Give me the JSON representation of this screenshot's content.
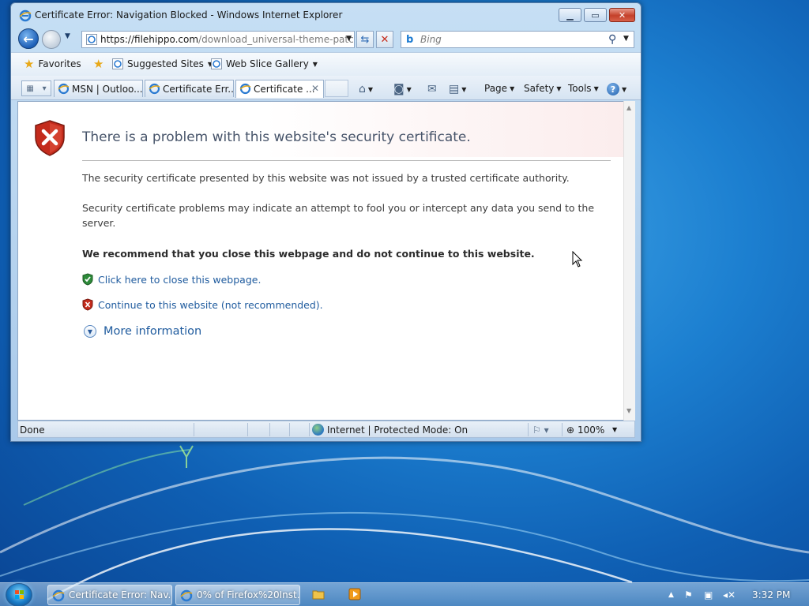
{
  "window": {
    "title": "Certificate Error: Navigation Blocked - Windows Internet Explorer"
  },
  "address": {
    "host": "https://filehippo.com",
    "path": "/download_universal-theme-patcher"
  },
  "search": {
    "placeholder": "Bing"
  },
  "favorites_bar": {
    "favorites": "Favorites",
    "suggested": "Suggested Sites",
    "web_slice": "Web Slice Gallery"
  },
  "tabs": [
    {
      "label": "MSN | Outloo...",
      "active": false
    },
    {
      "label": "Certificate Err...",
      "active": false
    },
    {
      "label": "Certificate ...",
      "active": true
    }
  ],
  "command_bar": {
    "page": "Page",
    "safety": "Safety",
    "tools": "Tools"
  },
  "content": {
    "title": "There is a problem with this website's security certificate.",
    "p1": "The security certificate presented by this website was not issued by a trusted certificate authority.",
    "p2": "Security certificate problems may indicate an attempt to fool you or intercept any data you send to the server.",
    "recommend": "We recommend that you close this webpage and do not continue to this website.",
    "close_link": "Click here to close this webpage.",
    "continue_link": "Continue to this website (not recommended).",
    "more_info": "More information"
  },
  "status_bar": {
    "status": "Done",
    "zone": "Internet | Protected Mode: On",
    "zoom": "100%"
  },
  "taskbar": {
    "items": [
      {
        "label": "Certificate Error: Nav..."
      },
      {
        "label": "0% of Firefox%20Inst..."
      }
    ],
    "clock": "3:32 PM"
  },
  "colors": {
    "link": "#1f5b9e",
    "title_text": "#47546a",
    "error_red": "#c42b1c",
    "safe_green": "#2e8b3a"
  }
}
